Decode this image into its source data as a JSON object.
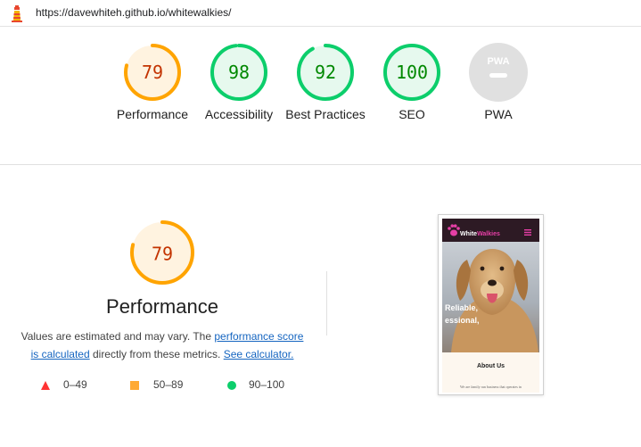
{
  "url": "https://davewhiteh.github.io/whitewalkies/",
  "gauges": [
    {
      "label": "Performance",
      "score": "79",
      "value": 79,
      "status": "average"
    },
    {
      "label": "Accessibility",
      "score": "98",
      "value": 98,
      "status": "pass"
    },
    {
      "label": "Best Practices",
      "score": "92",
      "value": 92,
      "status": "pass"
    },
    {
      "label": "SEO",
      "score": "100",
      "value": 100,
      "status": "pass"
    },
    {
      "label": "PWA",
      "score": "PWA",
      "value": null,
      "status": "na"
    }
  ],
  "performance": {
    "score": "79",
    "value": 79,
    "title": "Performance",
    "desc_before": "Values are estimated and may vary. The ",
    "link_score": "performance score is calculated",
    "desc_mid": " directly from these metrics. ",
    "link_calc": "See calculator."
  },
  "legend": [
    {
      "range": "0–49",
      "shape": "triangle",
      "color": "#ff3333"
    },
    {
      "range": "50–89",
      "shape": "square",
      "color": "#ffaa33"
    },
    {
      "range": "90–100",
      "shape": "circle",
      "color": "#0cce6b"
    }
  ],
  "screenshot": {
    "brand_white": "White",
    "brand_accent": "Walkies",
    "hero_line1": "Reliable,",
    "hero_line2": "essional,",
    "section_heading": "About Us",
    "body_snippet": "We are family run business that operates in"
  },
  "colors": {
    "average_stroke": "#ffa400",
    "average_fill": "#fff3e0",
    "average_text": "#c33300",
    "pass_stroke": "#0cce6b",
    "pass_fill": "#e6f9ee",
    "pass_text": "#008800",
    "na_fill": "#e0e0e0",
    "na_text": "#ffffff",
    "link": "#1565c0",
    "brand_accent": "#e63fa6"
  }
}
